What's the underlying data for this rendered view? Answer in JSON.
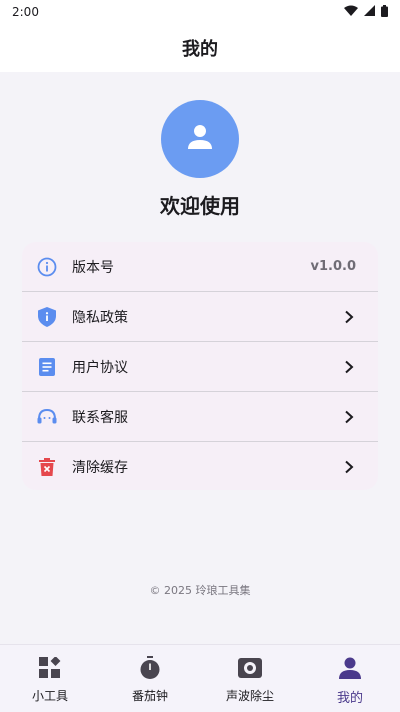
{
  "status_bar": {
    "time": "2:00"
  },
  "app_bar": {
    "title": "我的"
  },
  "profile": {
    "welcome": "欢迎使用"
  },
  "menu": {
    "items": [
      {
        "label": "版本号",
        "value": "v1.0.0",
        "icon": "info-icon"
      },
      {
        "label": "隐私政策",
        "icon": "shield-icon"
      },
      {
        "label": "用户协议",
        "icon": "document-icon"
      },
      {
        "label": "联系客服",
        "icon": "headset-icon"
      },
      {
        "label": "清除缓存",
        "icon": "trash-icon"
      }
    ]
  },
  "footer": {
    "text": "© 2025 玲琅工具集"
  },
  "bottom_nav": {
    "items": [
      {
        "label": "小工具",
        "icon": "widgets-icon"
      },
      {
        "label": "番茄钟",
        "icon": "timer-icon"
      },
      {
        "label": "声波除尘",
        "icon": "speaker-icon"
      },
      {
        "label": "我的",
        "icon": "person-icon",
        "active": true
      }
    ]
  },
  "colors": {
    "accent": "#4b3a8c",
    "avatar_bg": "#6b9cf2",
    "card_bg": "#f6eff7",
    "icon_blue": "#5b8def",
    "icon_red": "#e5484d"
  }
}
